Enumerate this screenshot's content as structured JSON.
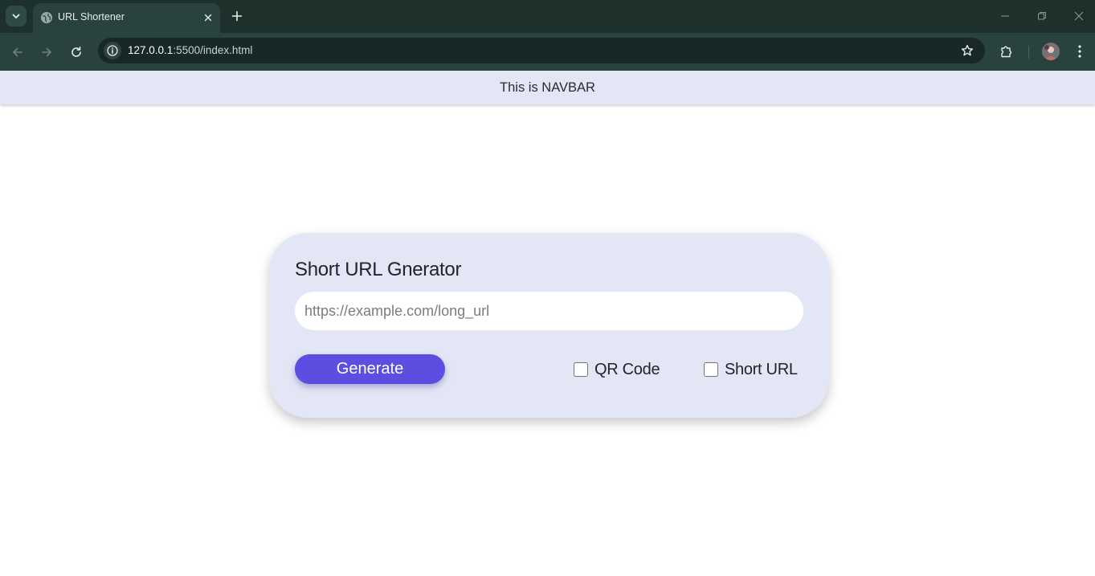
{
  "browser": {
    "tab_title": "URL Shortener",
    "address_host": "127.0.0.1",
    "address_path": ":5500/index.html"
  },
  "page": {
    "navbar_text": "This is NAVBAR",
    "card": {
      "title": "Short URL Gnerator",
      "input_placeholder": "https://example.com/long_url",
      "input_value": "",
      "generate_label": "Generate",
      "options": [
        {
          "label": "QR Code",
          "checked": false
        },
        {
          "label": "Short URL",
          "checked": false
        }
      ]
    }
  },
  "colors": {
    "accent": "#5b4ee0",
    "card_background": "#e3e6f4",
    "browser_frame": "#1d302c"
  },
  "icons": [
    "tab-search-icon",
    "globe-icon",
    "close-icon",
    "plus-icon",
    "minimize-icon",
    "restore-icon",
    "back-icon",
    "forward-icon",
    "reload-icon",
    "info-icon",
    "star-icon",
    "extensions-icon",
    "avatar",
    "more-icon"
  ]
}
